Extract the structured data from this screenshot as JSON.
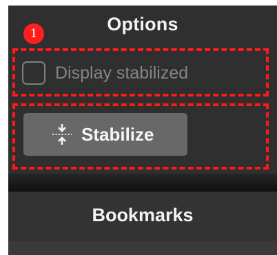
{
  "options_panel": {
    "title": "Options",
    "annotation_marker": "1",
    "display_stabilized": {
      "label": "Display stabilized",
      "checked": false
    },
    "stabilize_button": {
      "label": "Stabilize",
      "icon": "stabilize-icon"
    }
  },
  "bookmarks_section": {
    "title": "Bookmarks"
  },
  "colors": {
    "panel_background": "#2f2f2f",
    "button_background": "#686868",
    "highlight": "#ff1a1a",
    "marker": "#ff1f1f"
  }
}
